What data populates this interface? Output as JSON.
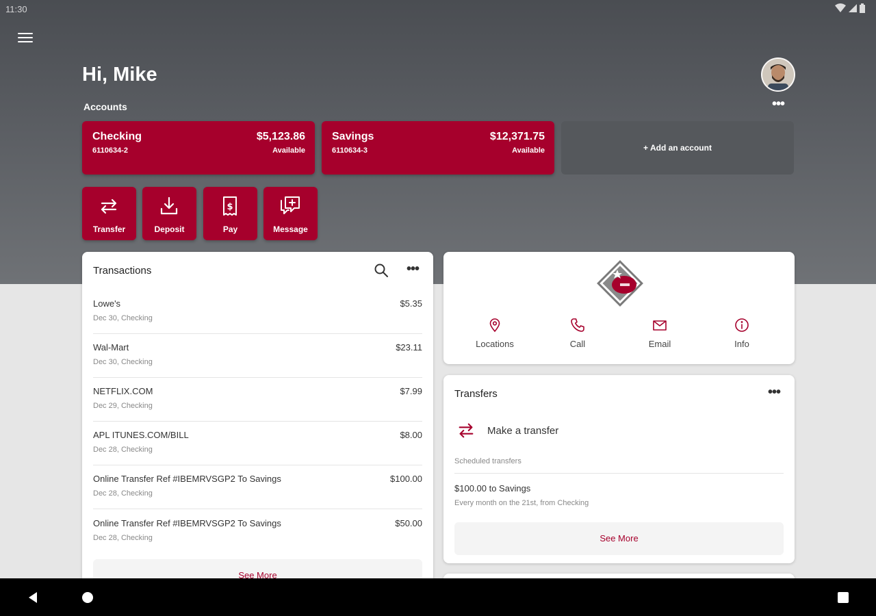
{
  "status_bar": {
    "time": "11:30"
  },
  "header": {
    "greeting": "Hi, Mike",
    "accounts_label": "Accounts",
    "more": "•••"
  },
  "accounts": [
    {
      "name": "Checking",
      "number": "6110634-2",
      "balance": "$5,123.86",
      "balance_label": "Available"
    },
    {
      "name": "Savings",
      "number": "6110634-3",
      "balance": "$12,371.75",
      "balance_label": "Available"
    }
  ],
  "add_account": "+ Add an account",
  "actions": [
    {
      "label": "Transfer",
      "icon": "transfer-icon"
    },
    {
      "label": "Deposit",
      "icon": "deposit-icon"
    },
    {
      "label": "Pay",
      "icon": "pay-icon"
    },
    {
      "label": "Message",
      "icon": "message-icon"
    }
  ],
  "transactions": {
    "title": "Transactions",
    "more": "•••",
    "items": [
      {
        "merchant": "Lowe's",
        "meta": "Dec 30, Checking",
        "amount": "$5.35"
      },
      {
        "merchant": "Wal-Mart",
        "meta": "Dec 30, Checking",
        "amount": "$23.11"
      },
      {
        "merchant": "NETFLIX.COM",
        "meta": "Dec 29, Checking",
        "amount": "$7.99"
      },
      {
        "merchant": "APL ITUNES.COM/BILL",
        "meta": "Dec 28, Checking",
        "amount": "$8.00"
      },
      {
        "merchant": "Online Transfer Ref #IBEMRVSGP2 To Savings",
        "meta": "Dec 28, Checking",
        "amount": "$100.00"
      },
      {
        "merchant": "Online Transfer Ref #IBEMRVSGP2 To Savings",
        "meta": "Dec 28, Checking",
        "amount": "$50.00"
      }
    ],
    "see_more": "See More"
  },
  "contact": [
    {
      "label": "Locations",
      "icon": "location-pin-icon"
    },
    {
      "label": "Call",
      "icon": "phone-icon"
    },
    {
      "label": "Email",
      "icon": "email-icon"
    },
    {
      "label": "Info",
      "icon": "info-icon"
    }
  ],
  "transfers": {
    "title": "Transfers",
    "more": "•••",
    "make_transfer": "Make a transfer",
    "scheduled_label": "Scheduled transfers",
    "scheduled": [
      {
        "title": "$100.00 to Savings",
        "subtitle": "Every month on the 21st, from Checking"
      }
    ],
    "see_more": "See More"
  },
  "colors": {
    "brand": "#a6002c",
    "hero": "#55585c",
    "add_card": "#55585c"
  }
}
